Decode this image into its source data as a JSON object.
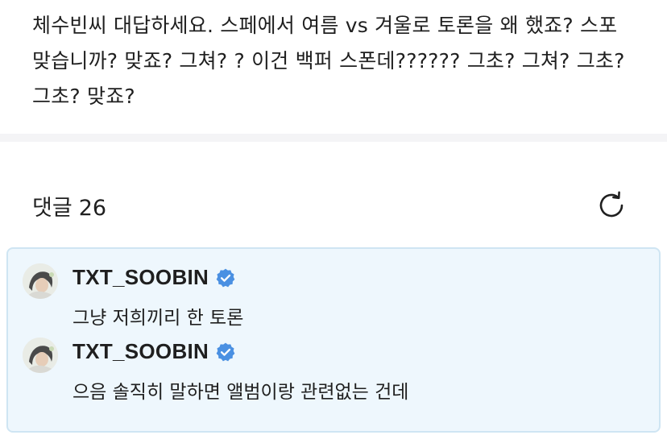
{
  "post": {
    "text": "체수빈씨 대답하세요. 스페에서 여름 vs 겨울로 토론을 왜 했죠? 스포 맞습니까? 맞죠? 그쳐? ? 이건 백퍼 스폰데?????? 그초? 그쳐? 그초? 그초? 맞죠?"
  },
  "comments_section": {
    "title": "댓글",
    "count": "26",
    "refresh_icon": "refresh-icon"
  },
  "comments": [
    {
      "author": "TXT_SOOBIN",
      "verified": true,
      "text": "그냥 저희끼리 한 토론",
      "avatar_icon": "avatar"
    },
    {
      "author": "TXT_SOOBIN",
      "verified": true,
      "text": "으음 솔직히 말하면 앨범이랑 관련없는 건데",
      "avatar_icon": "avatar"
    }
  ],
  "colors": {
    "comment_bg": "#eef7fd",
    "comment_border": "#cfe5f3",
    "verified_blue": "#4a90e2",
    "divider": "#f4f4f6"
  }
}
